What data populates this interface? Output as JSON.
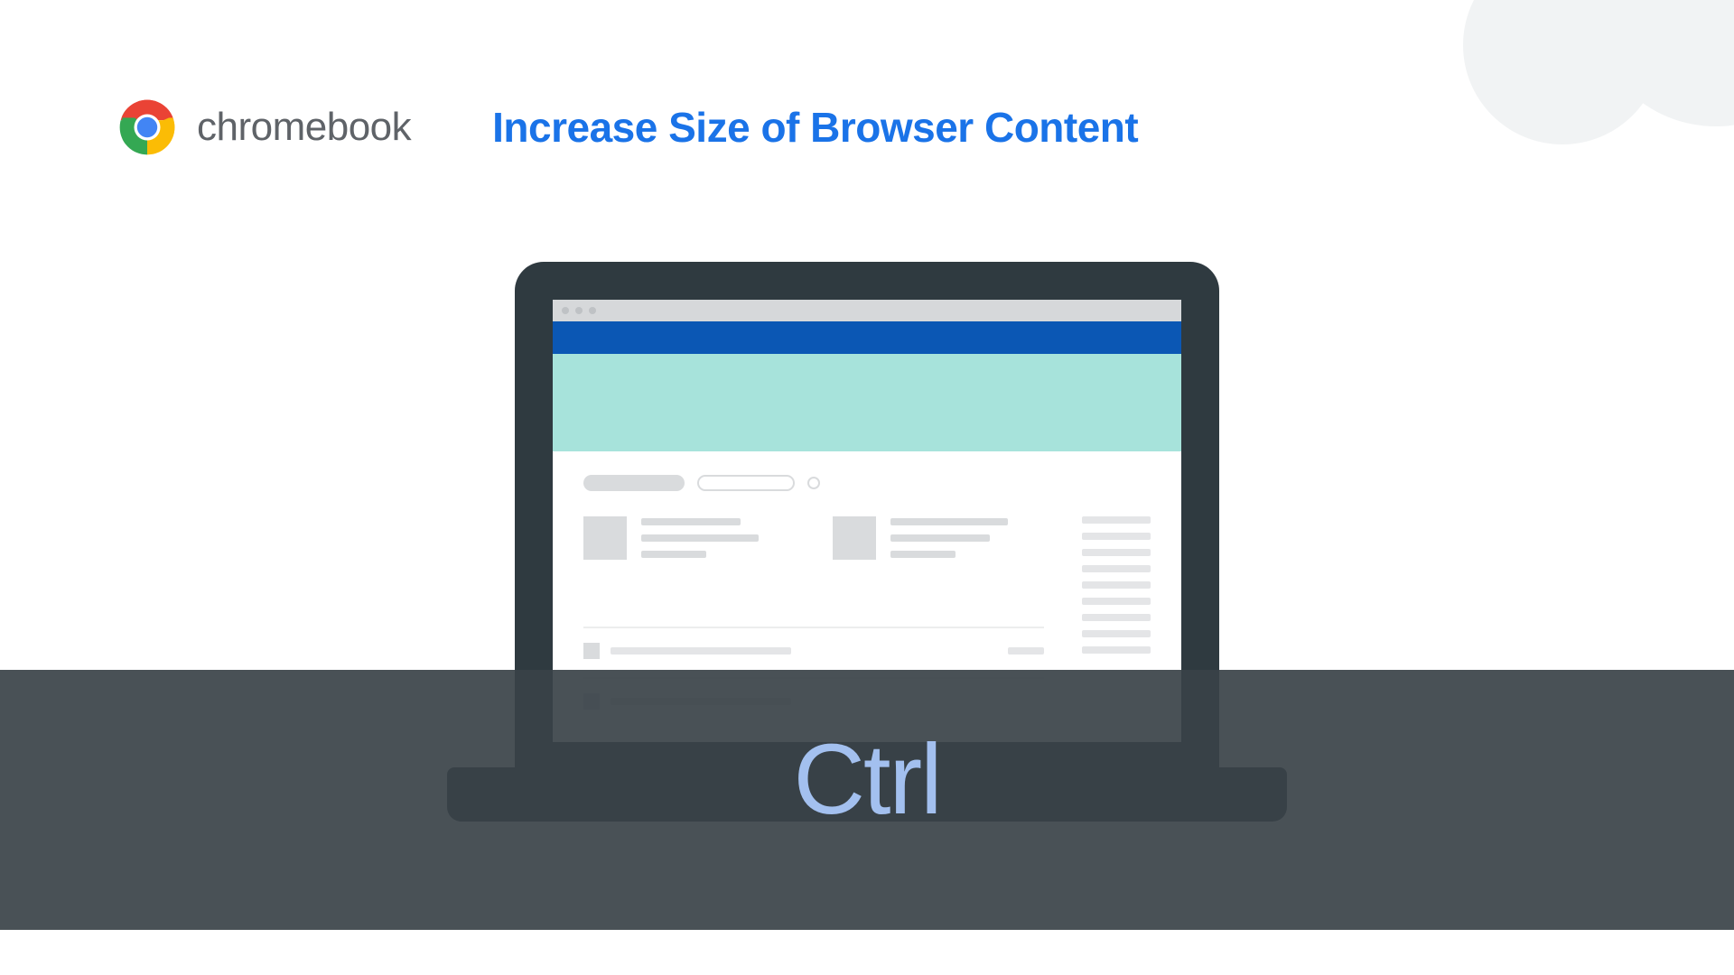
{
  "brand": "chromebook",
  "title": "Increase Size of Browser Content",
  "keyboard_hint": "Ctrl",
  "colors": {
    "title_blue": "#1a73e8",
    "brand_gray": "#5f6368",
    "key_text": "#a3c0ef",
    "laptop_body": "#2f3a40",
    "band": "rgba(57,66,72,0.92)",
    "browser_toolbar": "#0b57b4",
    "browser_hero": "#a7e3db"
  }
}
